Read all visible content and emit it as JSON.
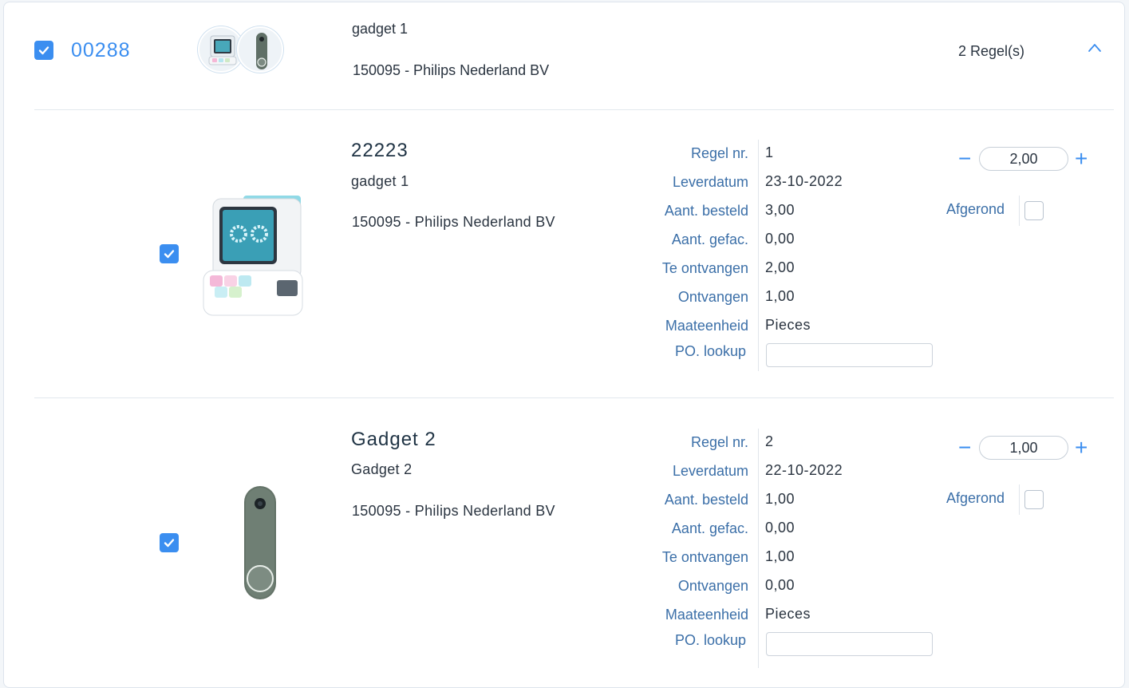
{
  "order": {
    "number": "00288",
    "title": "gadget 1",
    "supplier": "150095 - Philips Nederland BV",
    "line_count": "2 Regel(s)",
    "checked": true
  },
  "field_labels": {
    "line_no": "Regel nr.",
    "delivery_date": "Leverdatum",
    "qty_ordered": "Aant. besteld",
    "qty_invoiced": "Aant. gefac.",
    "to_receive": "Te ontvangen",
    "received": "Ontvangen",
    "unit": "Maateenheid",
    "po_lookup": "PO. lookup",
    "completed": "Afgerond"
  },
  "lines": [
    {
      "code": "22223",
      "name": "gadget 1",
      "supplier": "150095 - Philips Nederland BV",
      "line_no": "1",
      "delivery_date": "23-10-2022",
      "qty_ordered": "3,00",
      "qty_invoiced": "0,00",
      "to_receive": "2,00",
      "received": "1,00",
      "unit": "Pieces",
      "po_lookup": "",
      "quantity": "2,00",
      "checked": true,
      "completed": false
    },
    {
      "code": "Gadget 2",
      "name": "Gadget 2",
      "supplier": "150095 - Philips Nederland BV",
      "line_no": "2",
      "delivery_date": "22-10-2022",
      "qty_ordered": "1,00",
      "qty_invoiced": "0,00",
      "to_receive": "1,00",
      "received": "0,00",
      "unit": "Pieces",
      "po_lookup": "",
      "quantity": "1,00",
      "checked": true,
      "completed": false
    }
  ],
  "controls": {
    "minus": "−",
    "plus": "+"
  }
}
